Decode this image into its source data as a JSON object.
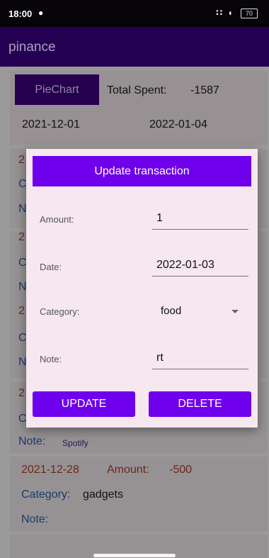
{
  "status_bar": {
    "time": "18:00",
    "chat_icon": "chat-bubble-icon",
    "signal_icons": "signal-wifi-icon",
    "battery": "70"
  },
  "app_bar": {
    "title": "pinance"
  },
  "summary": {
    "pie_chart_button": "PieChart",
    "total_label": "Total Spent:",
    "total_value": "-1587",
    "date_start": "2021-12-01",
    "date_end": "2022-01-04"
  },
  "transactions": [
    {
      "date": "2",
      "category_label": "C",
      "note_label": "N"
    },
    {
      "date": "2",
      "category_label": "C",
      "note_label": "N"
    },
    {
      "date": "2",
      "category_label": "C",
      "note_label": "N"
    },
    {
      "date": "2",
      "category_label": "C",
      "note_label": "Note:",
      "note_value": "Spotify"
    },
    {
      "date": "2021-12-28",
      "amount_label": "Amount:",
      "amount": "-500",
      "category_label": "Category:",
      "category": "gadgets",
      "note_label": "Note:"
    }
  ],
  "dialog": {
    "title": "Update transaction",
    "amount_label": "Amount:",
    "amount_value": "1",
    "date_label": "Date:",
    "date_value": "2022-01-03",
    "category_label": "Category:",
    "category_value": "food",
    "note_label": "Note:",
    "note_value": "rt",
    "update_button": "UPDATE",
    "delete_button": "DELETE"
  },
  "colors": {
    "accent": "#6f00ec",
    "app_bar": "#240052",
    "dialog_bg": "#f6e7f0"
  }
}
